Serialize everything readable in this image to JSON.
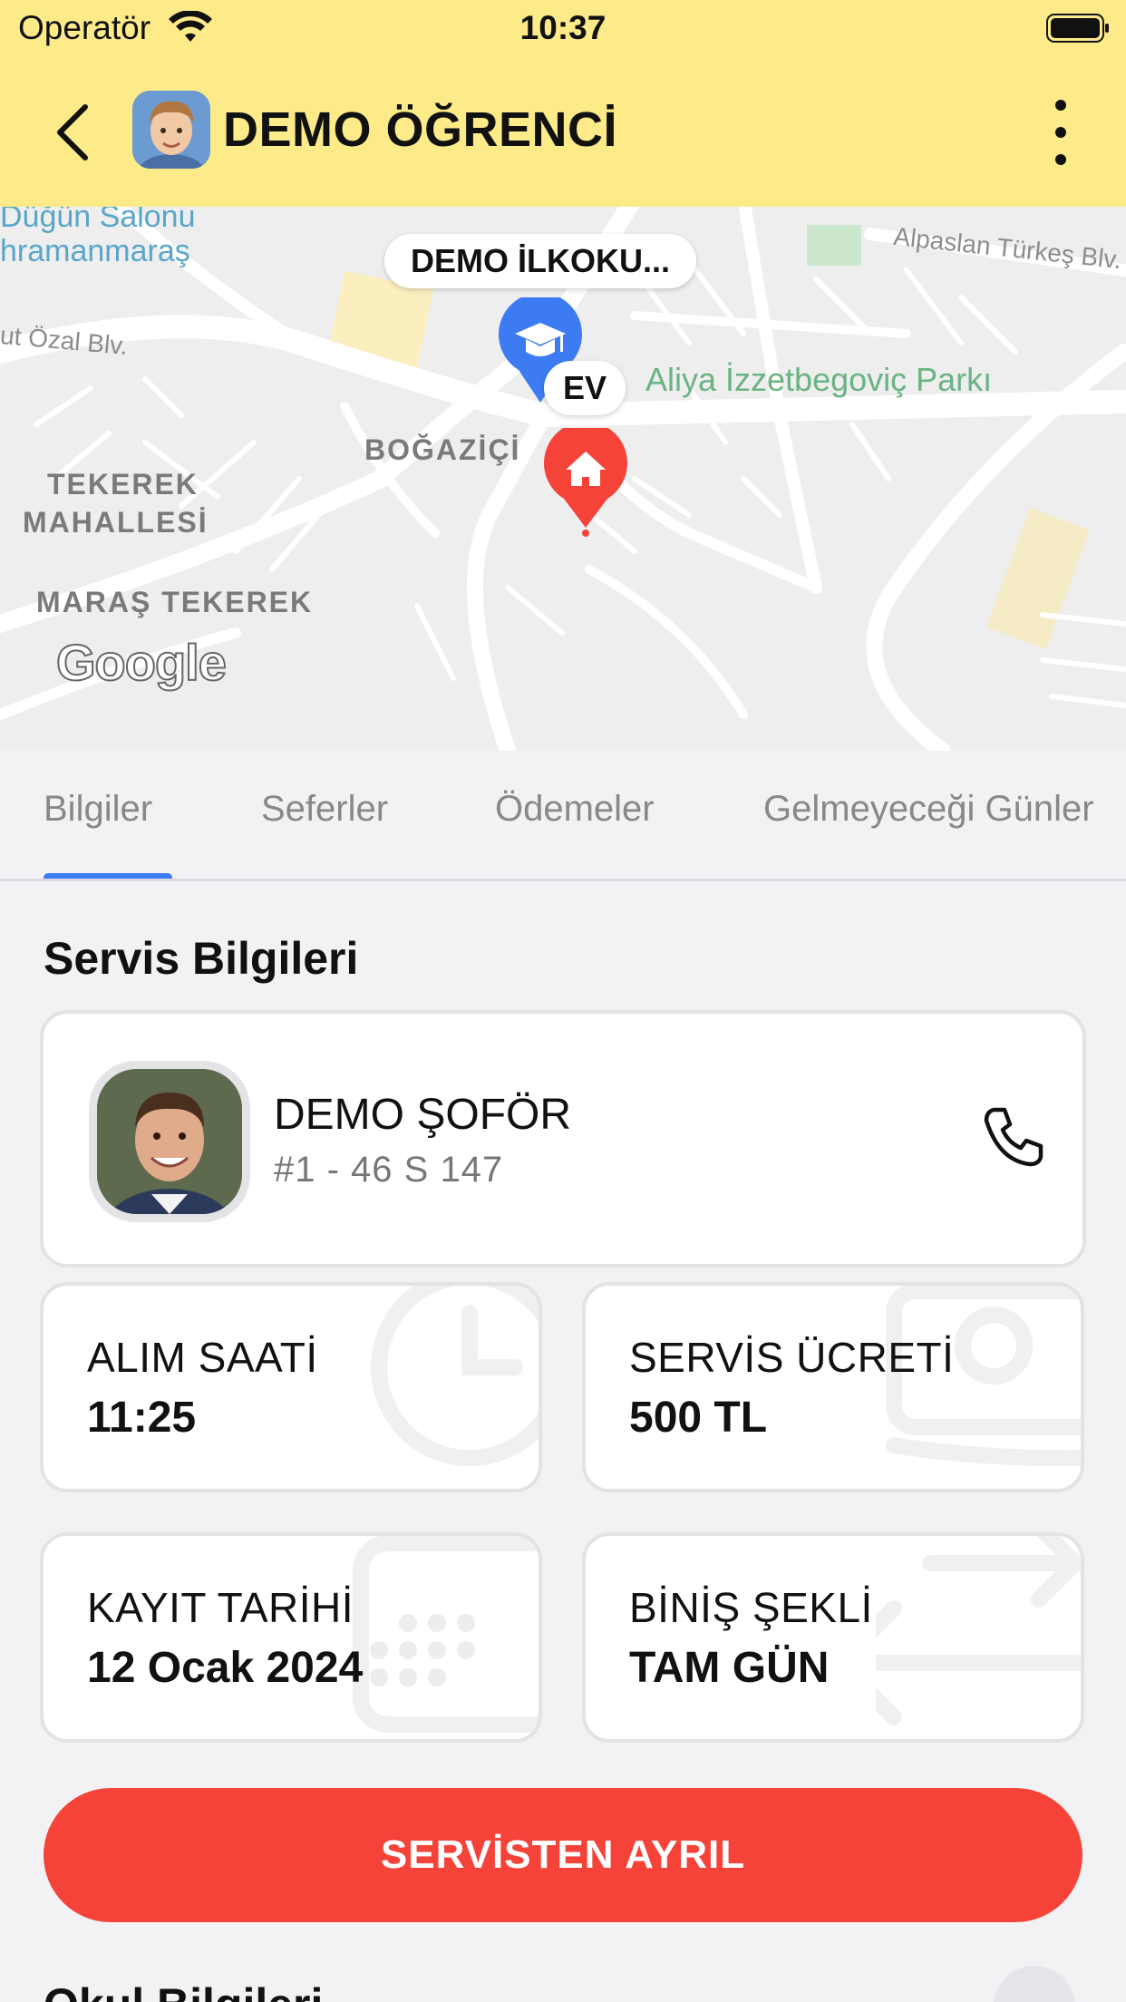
{
  "status_bar": {
    "operator": "Operatör",
    "time": "10:37"
  },
  "header": {
    "title": "DEMO ÖĞRENCİ"
  },
  "map": {
    "school_label": "DEMO İLKOKU...",
    "home_label": "EV",
    "places": {
      "park": "Aliya İzzetbegoviç Parkı",
      "district1": "BOĞAZİÇİ",
      "district2_line1": "TEKEREK",
      "district2_line2": "MAHALLESİ",
      "district3": "MARAŞ TEKEREK",
      "city1": "Düğün Salonu",
      "city2": "hramanmaraş",
      "road1": "ut Özal Blv.",
      "road2": "Alpaslan Türkeş Blv."
    },
    "attribution": "Google"
  },
  "tabs": [
    "Bilgiler",
    "Seferler",
    "Ödemeler",
    "Gelmeyeceği Günler"
  ],
  "active_tab": "Bilgiler",
  "service": {
    "section_title": "Servis Bilgileri",
    "driver": {
      "name": "DEMO ŞOFÖR",
      "plate": "#1 - 46 S 147"
    },
    "pickup": {
      "label": "ALIM SAATİ",
      "value": "11:25"
    },
    "fee": {
      "label": "SERVİS ÜCRETİ",
      "value": "500 TL"
    },
    "registration": {
      "label": "KAYIT TARİHİ",
      "value": "12 Ocak 2024"
    },
    "boarding": {
      "label": "BİNİŞ ŞEKLİ",
      "value": "TAM GÜN"
    },
    "leave_button": "SERVİSTEN AYRIL"
  },
  "next_section": {
    "title": "Okul Bilgileri"
  },
  "colors": {
    "header_bg": "#fdeb8a",
    "accent": "#3d7bf2",
    "danger": "#f5433a"
  }
}
